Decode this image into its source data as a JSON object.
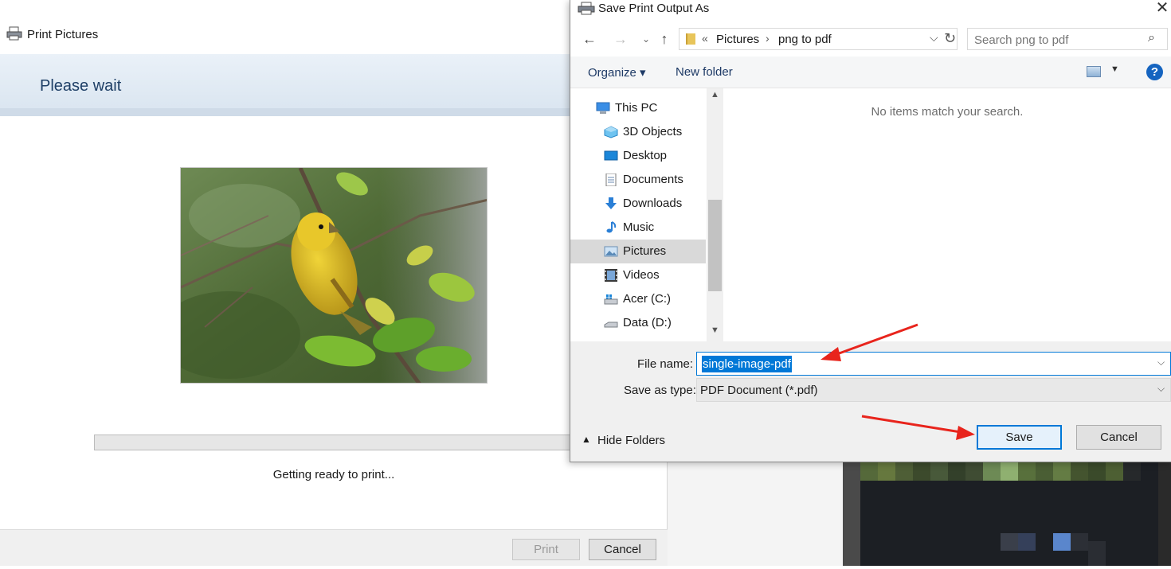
{
  "print_window": {
    "title": "Print Pictures",
    "heading": "Please wait",
    "status": "Getting ready to print...",
    "print_label": "Print",
    "cancel_label": "Cancel",
    "progress": 0
  },
  "save_dialog": {
    "title": "Save Print Output As",
    "close_label": "✕",
    "address": {
      "chevron": "«",
      "segments": [
        "Pictures",
        "png to pdf"
      ],
      "separator": "›"
    },
    "search": {
      "placeholder": "Search png to pdf"
    },
    "toolbar": {
      "organize_label": "Organize ▾",
      "new_folder_label": "New folder",
      "help_label": "?"
    },
    "nav": {
      "items": [
        {
          "label": "This PC",
          "icon": "computer-icon"
        },
        {
          "label": "3D Objects",
          "icon": "3d-objects-icon"
        },
        {
          "label": "Desktop",
          "icon": "desktop-icon"
        },
        {
          "label": "Documents",
          "icon": "documents-icon"
        },
        {
          "label": "Downloads",
          "icon": "downloads-icon"
        },
        {
          "label": "Music",
          "icon": "music-icon"
        },
        {
          "label": "Pictures",
          "icon": "pictures-icon",
          "selected": true
        },
        {
          "label": "Videos",
          "icon": "videos-icon"
        },
        {
          "label": "Acer (C:)",
          "icon": "drive-c-icon"
        },
        {
          "label": "Data (D:)",
          "icon": "drive-d-icon"
        }
      ]
    },
    "empty_message": "No items match your search.",
    "file_name_label": "File name:",
    "file_name_value": "single-image-pdf",
    "save_type_label": "Save as type:",
    "save_type_value": "PDF Document (*.pdf)",
    "hide_folders_label": "Hide Folders",
    "save_label": "Save",
    "cancel_label": "Cancel"
  },
  "colors": {
    "accent": "#0078d7",
    "annotation_arrow": "#e8241c",
    "banner_text": "#1e3f66"
  }
}
